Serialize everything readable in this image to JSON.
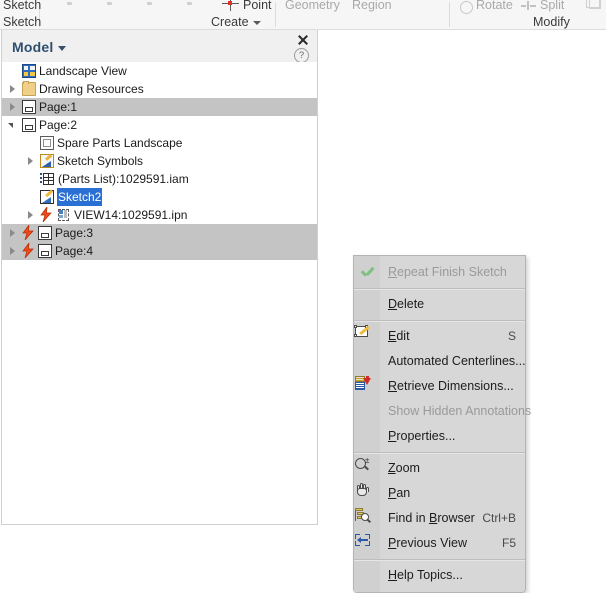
{
  "ribbon": {
    "panels": [
      {
        "name": "sketch",
        "top_label": "Sketch",
        "foot_label": "Sketch",
        "dimmed": false
      },
      {
        "name": "create",
        "top_label": "Point",
        "foot_label": "Create",
        "dimmed": false
      },
      {
        "name": "geometry",
        "top_label": "Geometry",
        "foot_label": "",
        "dimmed": true
      },
      {
        "name": "region",
        "top_label": "Region",
        "foot_label": "",
        "dimmed": true
      },
      {
        "name": "modify",
        "top_label": "Modify",
        "foot_label": "Modify",
        "dimmed": false
      }
    ],
    "sketch_top": "Sketch",
    "sketch_foot": "Sketch",
    "point": "Point",
    "create_foot": "Create",
    "geometry": "Geometry",
    "region": "Region",
    "rotate": "Rotate",
    "split": "Split",
    "modify_foot": "Modify"
  },
  "browser": {
    "title": "Model",
    "close_icon": "close-icon",
    "help_icon": "help-icon",
    "tree": [
      {
        "label": "Landscape View",
        "icon": "landscape-view-icon",
        "indent": 0,
        "expander": "none",
        "selected": false,
        "highlighted": false
      },
      {
        "label": "Drawing Resources",
        "icon": "folder-icon",
        "indent": 0,
        "expander": "collapsed",
        "selected": false,
        "highlighted": false
      },
      {
        "label": "Page:1",
        "icon": "page-icon",
        "indent": 0,
        "expander": "collapsed",
        "selected": true,
        "highlighted": false
      },
      {
        "label": "Page:2",
        "icon": "page-icon",
        "indent": 0,
        "expander": "expanded",
        "selected": false,
        "highlighted": false
      },
      {
        "label": "Spare Parts Landscape",
        "icon": "border-icon",
        "indent": 1,
        "expander": "none",
        "selected": false,
        "highlighted": false
      },
      {
        "label": "Sketch Symbols",
        "icon": "sketch-symbols-icon",
        "indent": 1,
        "expander": "collapsed",
        "selected": false,
        "highlighted": false
      },
      {
        "label": "(Parts List):1029591.iam",
        "icon": "parts-list-icon",
        "indent": 1,
        "expander": "none",
        "selected": false,
        "highlighted": false
      },
      {
        "label": "Sketch2",
        "icon": "sketch-icon",
        "indent": 1,
        "expander": "none",
        "selected": false,
        "highlighted": true
      },
      {
        "label": "VIEW14:1029591.ipn",
        "icon": "view-icon",
        "indent": 1,
        "expander": "collapsed",
        "selected": false,
        "highlighted": false,
        "bolt": true
      },
      {
        "label": "Page:3",
        "icon": "page-icon",
        "indent": 0,
        "expander": "collapsed",
        "selected": true,
        "highlighted": false,
        "bolt": true
      },
      {
        "label": "Page:4",
        "icon": "page-icon",
        "indent": 0,
        "expander": "collapsed",
        "selected": true,
        "highlighted": false,
        "bolt": true
      }
    ]
  },
  "canvas": {
    "sketch_rect_color": "#0e8a18"
  },
  "context_menu": {
    "items": [
      {
        "id": "repeat-finish-sketch",
        "label": "Repeat Finish Sketch",
        "accel": "R",
        "shortcut": "",
        "icon": "check-icon",
        "disabled": true,
        "separator_after": true
      },
      {
        "id": "delete",
        "label": "Delete",
        "accel": "D",
        "shortcut": "",
        "icon": "",
        "disabled": false,
        "separator_after": true
      },
      {
        "id": "edit",
        "label": "Edit",
        "accel": "E",
        "shortcut": "S",
        "icon": "edit-sketch-icon",
        "disabled": false,
        "separator_after": false
      },
      {
        "id": "automated-centerlines",
        "label": "Automated Centerlines...",
        "accel": "",
        "shortcut": "",
        "icon": "",
        "disabled": false,
        "separator_after": false
      },
      {
        "id": "retrieve-dimensions",
        "label": "Retrieve Dimensions...",
        "accel": "R",
        "shortcut": "",
        "icon": "retrieve-dimensions-icon",
        "disabled": false,
        "separator_after": false
      },
      {
        "id": "show-hidden-annotations",
        "label": "Show Hidden Annotations",
        "accel": "",
        "shortcut": "",
        "icon": "",
        "disabled": true,
        "separator_after": false
      },
      {
        "id": "properties",
        "label": "Properties...",
        "accel": "P",
        "shortcut": "",
        "icon": "",
        "disabled": false,
        "separator_after": true
      },
      {
        "id": "zoom",
        "label": "Zoom",
        "accel": "Z",
        "shortcut": "",
        "icon": "zoom-icon",
        "disabled": false,
        "separator_after": false
      },
      {
        "id": "pan",
        "label": "Pan",
        "accel": "P",
        "shortcut": "",
        "icon": "pan-hand-icon",
        "disabled": false,
        "separator_after": false
      },
      {
        "id": "find-in-browser",
        "label": "Find in Browser",
        "accel": "B",
        "shortcut": "Ctrl+B",
        "icon": "find-in-browser-icon",
        "disabled": false,
        "separator_after": false
      },
      {
        "id": "previous-view",
        "label": "Previous View",
        "accel": "P",
        "shortcut": "F5",
        "icon": "previous-view-icon",
        "disabled": false,
        "separator_after": true
      },
      {
        "id": "help-topics",
        "label": "Help Topics...",
        "accel": "H",
        "shortcut": "",
        "icon": "",
        "disabled": false,
        "separator_after": false
      }
    ]
  }
}
